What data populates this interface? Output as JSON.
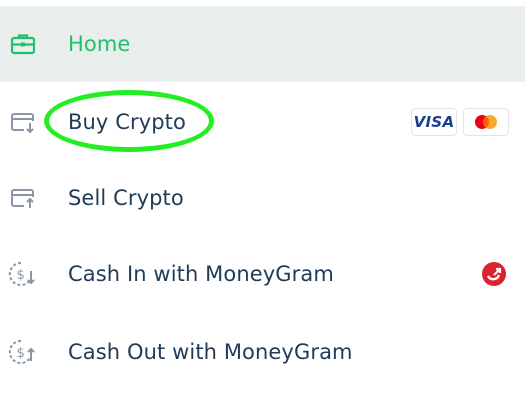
{
  "menu": {
    "items": [
      {
        "label": "Home",
        "icon": "briefcase-icon",
        "active": true
      },
      {
        "label": "Buy Crypto",
        "icon": "card-download-icon",
        "badges": [
          "VISA",
          "mastercard-logo"
        ]
      },
      {
        "label": "Sell Crypto",
        "icon": "card-upload-icon"
      },
      {
        "label": "Cash In with MoneyGram",
        "icon": "dollar-coin-download-icon",
        "badge": "moneygram-logo"
      },
      {
        "label": "Cash Out with MoneyGram",
        "icon": "dollar-coin-upload-icon"
      }
    ]
  },
  "colors": {
    "active_green": "#1fc26a",
    "text_navy": "#1f3b57",
    "active_bg": "#e9eeec",
    "highlight_green": "#22ee22",
    "icon_gray": "#8a96a3",
    "visa_blue": "#1a3d8f",
    "mastercard_red": "#eb001b",
    "mastercard_orange": "#f79e1b",
    "moneygram_red": "#d9232e"
  }
}
